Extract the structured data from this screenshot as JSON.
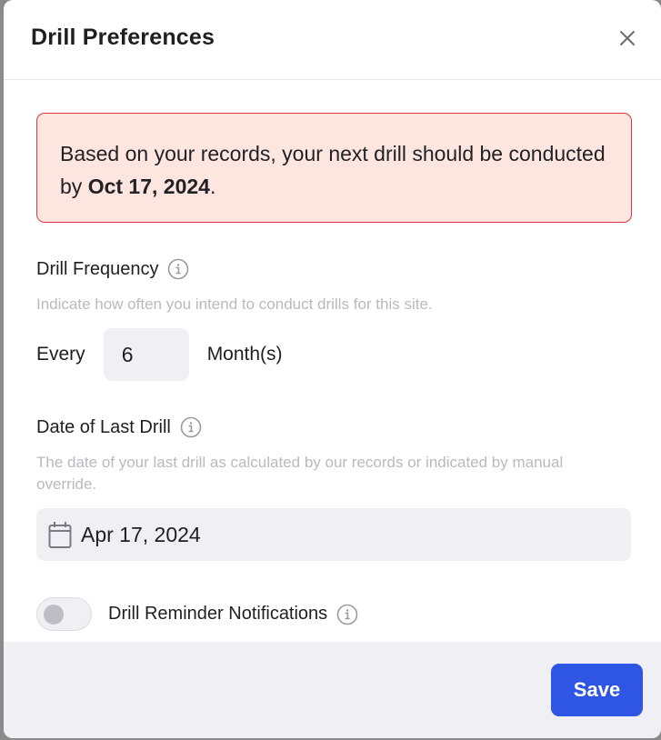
{
  "dialog": {
    "title": "Drill Preferences",
    "close_icon": "close-icon"
  },
  "alert": {
    "text_before": "Based on your records, your next drill should be conducted by ",
    "date": "Oct 17, 2024",
    "text_after": "."
  },
  "frequency": {
    "label": "Drill Frequency",
    "info_icon": "info-icon",
    "help": "Indicate how often you intend to conduct drills for this site.",
    "prefix": "Every",
    "value": "6",
    "unit": "Month(s)"
  },
  "last_drill": {
    "label": "Date of Last Drill",
    "info_icon": "info-icon",
    "help": "The date of your last drill as calculated by our records or indicated by manual override.",
    "calendar_icon": "calendar-icon",
    "date": "Apr 17, 2024"
  },
  "notifications": {
    "label": "Drill Reminder Notifications",
    "enabled": false,
    "info_icon": "info-icon"
  },
  "footer": {
    "save_label": "Save"
  },
  "colors": {
    "accent": "#2f55e4",
    "alert_bg": "#fde6df",
    "alert_border": "#e3343f"
  }
}
